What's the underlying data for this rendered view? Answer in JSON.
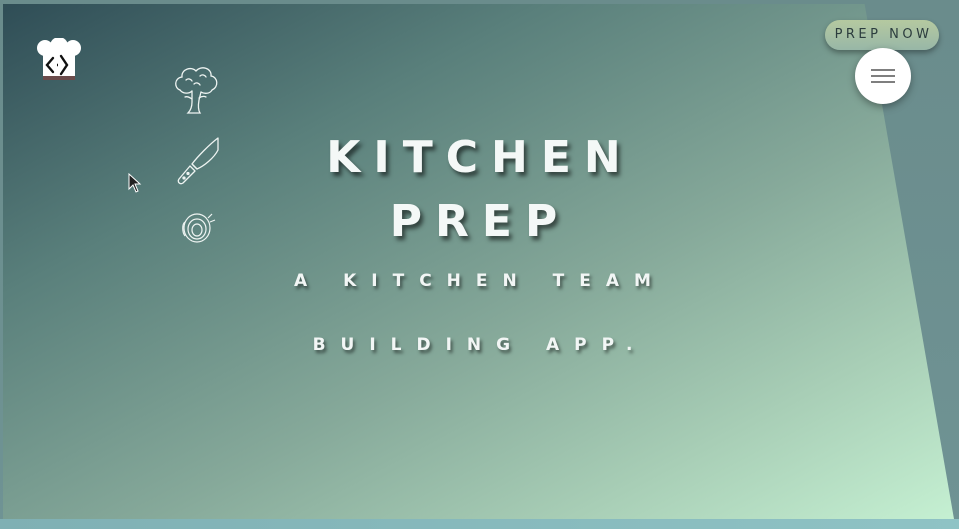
{
  "hero": {
    "title_line1": "KITCHEN",
    "title_line2": "PREP",
    "subtitle_line1": "A KITCHEN TEAM",
    "subtitle_line2": "BUILDING APP."
  },
  "header": {
    "logo_icon": "chef-hat-code-icon",
    "cta_label": "PREP NOW",
    "menu_icon": "hamburger-menu-icon"
  },
  "side_icons": [
    {
      "icon": "broccoli-icon"
    },
    {
      "icon": "knife-icon"
    },
    {
      "icon": "onion-icon"
    }
  ],
  "colors": {
    "gradient_dark": "#2f4d56",
    "gradient_light": "#c5f0d2",
    "cta_background": "#a8c0a4",
    "menu_button": "#ffffff",
    "title_text": "#f4f8f7"
  }
}
